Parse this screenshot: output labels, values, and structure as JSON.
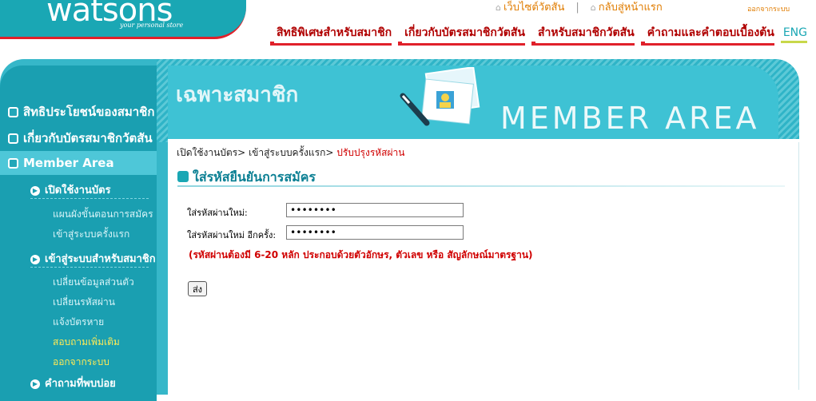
{
  "header": {
    "logo_text": "watsons",
    "logo_tagline": "your personal store",
    "top_links": [
      "เว็บไซต์วัตสัน",
      "กลับสู่หน้าแรก"
    ],
    "logout": "ออกจากระบบ",
    "nav": [
      "สิทธิพิเศษสำหรับสมาชิก",
      "เกี่ยวกับบัตรสมาชิกวัตสัน",
      "สำหรับสมาชิกวัตสัน",
      "คำถามและคำตอบเบื้องต้น"
    ],
    "lang": "ENG"
  },
  "banner": {
    "title": "เฉพาะสมาชิก",
    "member_area": "MEMBER AREA"
  },
  "sidebar": {
    "items": [
      "สิทธิประโยชน์ของสมาชิก",
      "เกี่ยวกับบัตรสมาชิกวัตสัน",
      "Member Area"
    ],
    "groups": [
      {
        "title": "เปิดใช้งานบัตร",
        "links": [
          "แผนผังขั้นตอนการสมัคร",
          "เข้าสู่ระบบครั้งแรก"
        ]
      },
      {
        "title": "เข้าสู่ระบบสำหรับสมาชิก",
        "links": [
          "เปลี่ยนข้อมูลส่วนตัว",
          "เปลี่ยนรหัสผ่าน",
          "แจ้งบัตรหาย",
          "สอบถามเพิ่มเติม",
          "ออกจากระบบ"
        ]
      },
      {
        "title": "คำถามที่พบบ่อย",
        "links": []
      }
    ]
  },
  "breadcrumb": {
    "step1": "เปิดใช้งานบัตร>",
    "step2": "เข้าสู่ระบบครั้งแรก>",
    "current": "ปรับปรุงรหัสผ่าน"
  },
  "form": {
    "title": "ใส่รหัสยืนยันการสมัคร",
    "new_password_label": "ใส่รหัสผ่านใหม่:",
    "new_password_value": "••••••••",
    "confirm_password_label": "ใส่รหัสผ่านใหม่ อีกครั้ง:",
    "confirm_password_value": "••••••••",
    "hint": "(รหัสผ่านต้องมี 6-20 หลัก ประกอบด้วยตัวอักษร, ตัวเลข หรือ สัญลักษณ์มาตรฐาน)",
    "submit_label": "ส่ง"
  },
  "colors": {
    "brand_teal": "#1aa7b4",
    "brand_red": "#e0202a",
    "link_orange": "#e07c00"
  }
}
